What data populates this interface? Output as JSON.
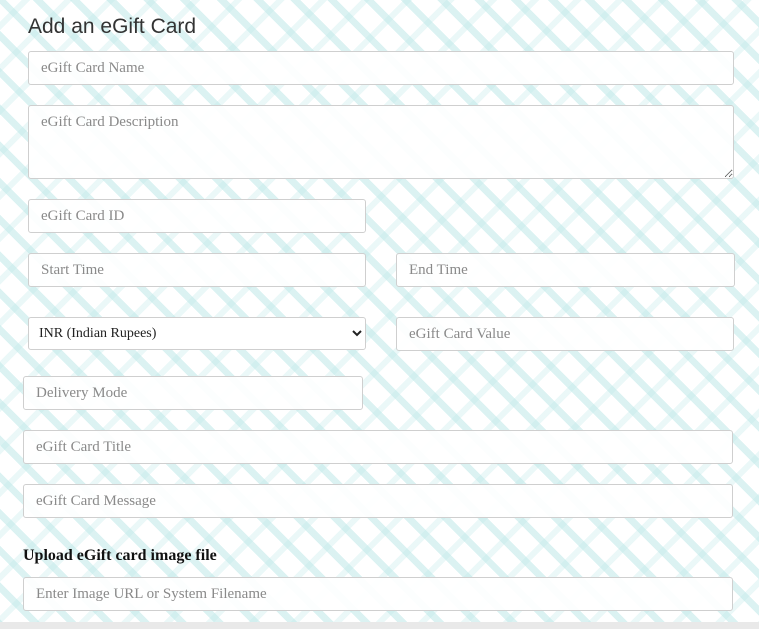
{
  "form": {
    "title": "Add an eGift Card",
    "name_placeholder": "eGift Card Name",
    "description_placeholder": "eGift Card Description",
    "id_placeholder": "eGift Card ID",
    "start_time_placeholder": "Start Time",
    "end_time_placeholder": "End Time",
    "currency": {
      "selected": "INR (Indian Rupees)",
      "options": [
        "INR (Indian Rupees)"
      ]
    },
    "value_placeholder": "eGift Card Value",
    "delivery_mode_placeholder": "Delivery Mode",
    "card_title_placeholder": "eGift Card Title",
    "message_placeholder": "eGift Card Message",
    "upload_label": "Upload eGift card image file",
    "image_placeholder": "Enter Image URL or System Filename"
  }
}
